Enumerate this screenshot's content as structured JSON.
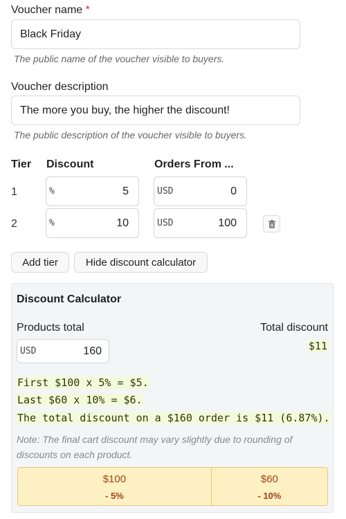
{
  "voucher_name": {
    "label": "Voucher name",
    "required_mark": "*",
    "value": "Black Friday",
    "help": "The public name of the voucher visible to buyers."
  },
  "voucher_description": {
    "label": "Voucher description",
    "value": "The more you buy, the higher the discount!",
    "help": "The public description of the voucher visible to buyers."
  },
  "tiers_table": {
    "headers": {
      "tier": "Tier",
      "discount": "Discount",
      "orders_from": "Orders From ..."
    },
    "rows": [
      {
        "tier": "1",
        "discount_prefix": "%",
        "discount": "5",
        "orders_prefix": "USD",
        "orders_from": "0"
      },
      {
        "tier": "2",
        "discount_prefix": "%",
        "discount": "10",
        "orders_prefix": "USD",
        "orders_from": "100"
      }
    ],
    "delete_icon": "trash-icon"
  },
  "buttons": {
    "add_tier": "Add tier",
    "hide_calculator": "Hide discount calculator"
  },
  "calculator": {
    "title": "Discount Calculator",
    "products_total_label": "Products total",
    "products_total_prefix": "USD",
    "products_total_value": "160",
    "total_discount_label": "Total discount",
    "total_discount_value": "$11",
    "lines": [
      "First $100 x 5% = $5.",
      "Last $60 x 10% = $6.",
      "The total discount on a $160 order is $11 (6.87%)."
    ],
    "note": "Note: The final cart discount may vary slightly due to rounding of discounts on each product.",
    "segments": [
      {
        "amount": "$100",
        "discount": "- 5%",
        "share": 0.625
      },
      {
        "amount": "$60",
        "discount": "- 10%",
        "share": 0.375
      }
    ]
  },
  "colors": {
    "required": "#c0392b",
    "code_highlight": "#f3fadc",
    "segment_bg": "#fdf0c2",
    "segment_text": "#a0431a"
  }
}
